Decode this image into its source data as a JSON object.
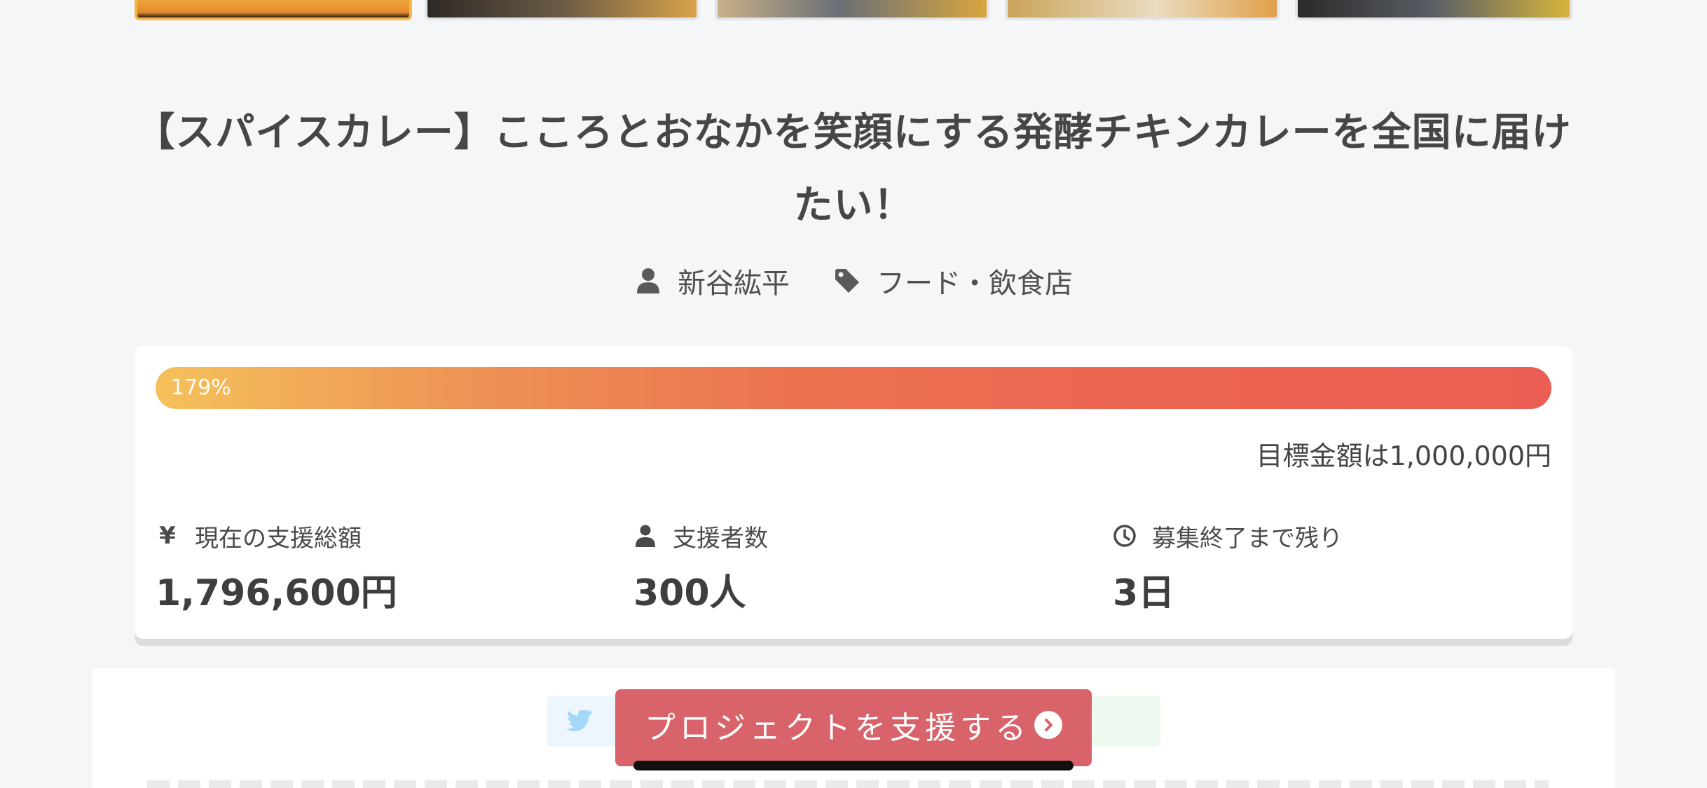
{
  "project": {
    "title": "【スパイスカレー】こころとおなかを笑顔にする発酵チキンカレーを全国に届けたい！",
    "owner": "新谷紘平",
    "category": "フード・飲食店"
  },
  "thumbnails": [
    {
      "name": "thumb-1",
      "active": true,
      "color": "#f0a63c"
    },
    {
      "name": "thumb-2",
      "active": false,
      "color": "#2e2a26"
    },
    {
      "name": "thumb-3",
      "active": false,
      "color": "#6a6f75"
    },
    {
      "name": "thumb-4",
      "active": false,
      "color": "#c9a65a"
    },
    {
      "name": "thumb-5",
      "active": false,
      "color": "#3a3a3a"
    }
  ],
  "funding": {
    "progress_percent": 179,
    "progress_label": "179%",
    "goal_text": "目標金額は1,000,000円",
    "stats": [
      {
        "icon": "yen-icon",
        "icon_glyph": "¥",
        "label": "現在の支援総額",
        "value": "1,796,600円"
      },
      {
        "icon": "person-icon",
        "icon_glyph": "",
        "label": "支援者数",
        "value": "300人"
      },
      {
        "icon": "clock-icon",
        "icon_glyph": "",
        "label": "募集終了まで残り",
        "value": "3日"
      }
    ]
  },
  "cta": {
    "support_label": "プロジェクトを支援する"
  },
  "colors": {
    "accent": "#d9636a",
    "progress_start": "#f5c15a",
    "progress_end": "#ec5e53",
    "background": "#f5f6f8"
  }
}
